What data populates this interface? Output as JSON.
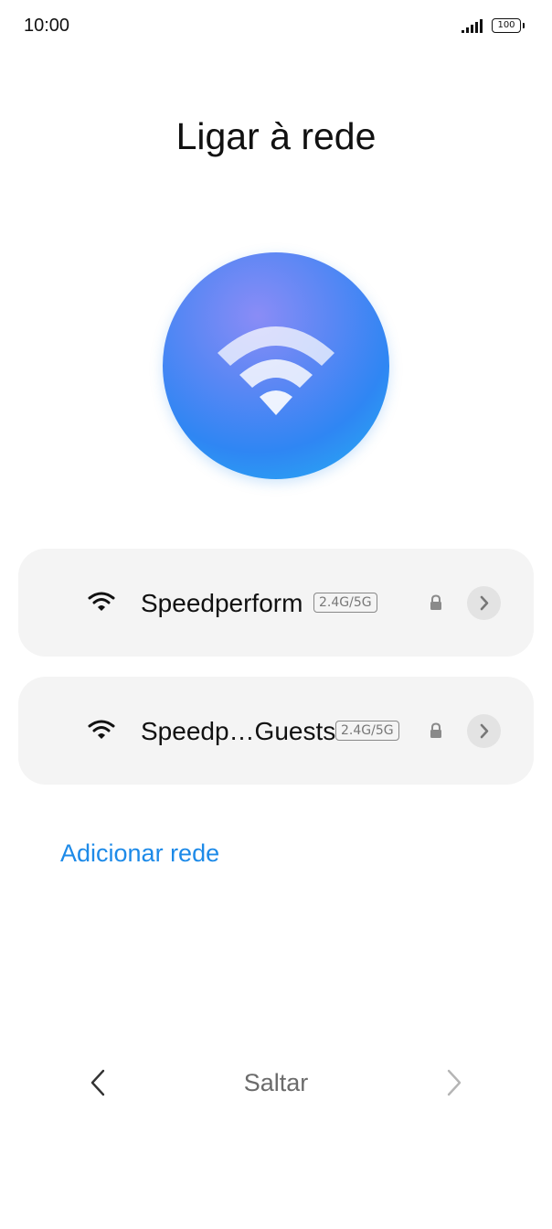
{
  "status_bar": {
    "time": "10:00",
    "signal_icon": "cellular-signal-icon",
    "battery_level": "100"
  },
  "title": "Ligar à rede",
  "hero_icon": "wifi-icon",
  "networks": [
    {
      "name": "Speedperform",
      "band": "2.4G/5G",
      "secured": true,
      "icon": "wifi-icon"
    },
    {
      "name": "Speedp…Guests",
      "band": "2.4G/5G",
      "secured": true,
      "icon": "wifi-icon"
    }
  ],
  "add_network_label": "Adicionar rede",
  "nav": {
    "back_icon": "chevron-left-icon",
    "skip_label": "Saltar",
    "next_icon": "chevron-right-icon"
  },
  "colors": {
    "accent": "#1d8ae8",
    "card_bg": "#f4f4f4",
    "hero_gradient": [
      "#8a8cf6",
      "#2f86f3",
      "#27b4f4"
    ]
  }
}
